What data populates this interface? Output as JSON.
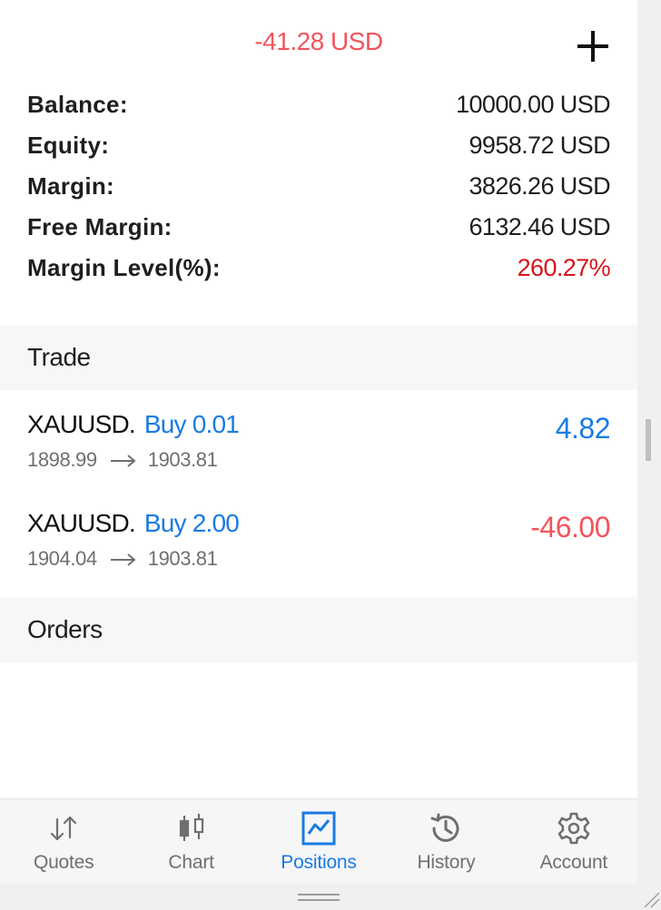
{
  "colors": {
    "loss": "#f2545b",
    "margin_level": "#d6141c",
    "accent_blue": "#1a7be2",
    "nav_inactive": "#6f6f6f"
  },
  "header": {
    "floating_pl": "-41.28 USD",
    "add_icon": "plus-icon"
  },
  "summary": [
    {
      "label": "Balance:",
      "value": "10000.00 USD"
    },
    {
      "label": "Equity:",
      "value": "9958.72 USD"
    },
    {
      "label": "Margin:",
      "value": "3826.26 USD"
    },
    {
      "label": "Free Margin:",
      "value": "6132.46 USD"
    },
    {
      "label": "Margin Level(%):",
      "value": "260.27%"
    }
  ],
  "sections": {
    "trade_title": "Trade",
    "orders_title": "Orders"
  },
  "positions": [
    {
      "symbol": "XAUUSD.",
      "direction": "Buy 0.01",
      "open_price": "1898.99",
      "current_price": "1903.81",
      "profit": "4.82"
    },
    {
      "symbol": "XAUUSD.",
      "direction": "Buy 2.00",
      "open_price": "1904.04",
      "current_price": "1903.81",
      "profit": "-46.00"
    }
  ],
  "nav": {
    "active": "Positions",
    "items": [
      {
        "label": "Quotes",
        "icon": "quotes-arrows-icon"
      },
      {
        "label": "Chart",
        "icon": "candlestick-chart-icon"
      },
      {
        "label": "Positions",
        "icon": "positions-chart-icon"
      },
      {
        "label": "History",
        "icon": "history-clock-icon"
      },
      {
        "label": "Account",
        "icon": "gear-icon"
      }
    ]
  }
}
